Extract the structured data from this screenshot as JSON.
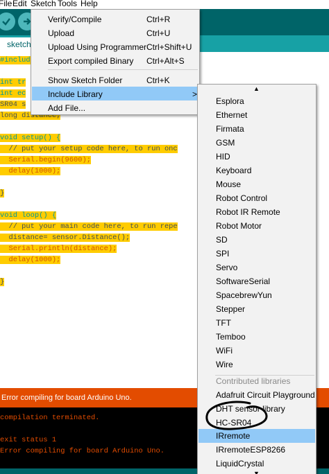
{
  "menubar": {
    "items": [
      "File",
      "Edit",
      "Sketch",
      "Tools",
      "Help"
    ]
  },
  "tab": {
    "label": "sketch"
  },
  "code": {
    "lines": [
      "#include",
      "int tr",
      "int ec",
      "SR04 s",
      "long distance;",
      "",
      "void setup() {",
      "  // put your setup code here, to run onc",
      "  Serial.begin(9600);",
      "  delay(1000);",
      "",
      "}",
      "",
      "void loop() {",
      "  // put your main code here, to run repe",
      "  distance= sensor.Distance();",
      "  Serial.println(distance);",
      "  delay(1000);",
      "",
      "}"
    ]
  },
  "console": {
    "status": "Error compiling for board Arduino Uno.",
    "lines": [
      "compilation terminated.",
      "",
      "exit status 1",
      "Error compiling for board Arduino Uno."
    ]
  },
  "sketch_menu": {
    "items": [
      {
        "label": "Verify/Compile",
        "shortcut": "Ctrl+R"
      },
      {
        "label": "Upload",
        "shortcut": "Ctrl+U"
      },
      {
        "label": "Upload Using Programmer",
        "shortcut": "Ctrl+Shift+U"
      },
      {
        "label": "Export compiled Binary",
        "shortcut": "Ctrl+Alt+S"
      },
      {
        "label": "Show Sketch Folder",
        "shortcut": "Ctrl+K"
      },
      {
        "label": "Include Library",
        "shortcut": ""
      },
      {
        "label": "Add File...",
        "shortcut": ""
      }
    ],
    "submenu_arrow": ">"
  },
  "library_menu": {
    "scroll_up": "▲",
    "scroll_down": "▼",
    "items": [
      "Esplora",
      "Ethernet",
      "Firmata",
      "GSM",
      "HID",
      "Keyboard",
      "Mouse",
      "Robot Control",
      "Robot IR Remote",
      "Robot Motor",
      "SD",
      "SPI",
      "Servo",
      "SoftwareSerial",
      "SpacebrewYun",
      "Stepper",
      "TFT",
      "Temboo",
      "WiFi",
      "Wire"
    ],
    "contributed_header": "Contributed libraries",
    "contributed_items": [
      "Adafruit Circuit Playground",
      "DHT sensor library",
      "HC-SR04",
      "IRremote",
      "IRremoteESP8266",
      "LiquidCrystal"
    ],
    "selected": "IRremote"
  },
  "colors": {
    "toolbar": "#006468",
    "highlight": "#ffcc00",
    "error_bar": "#e34c00",
    "menu_selection": "#91c9f7"
  }
}
